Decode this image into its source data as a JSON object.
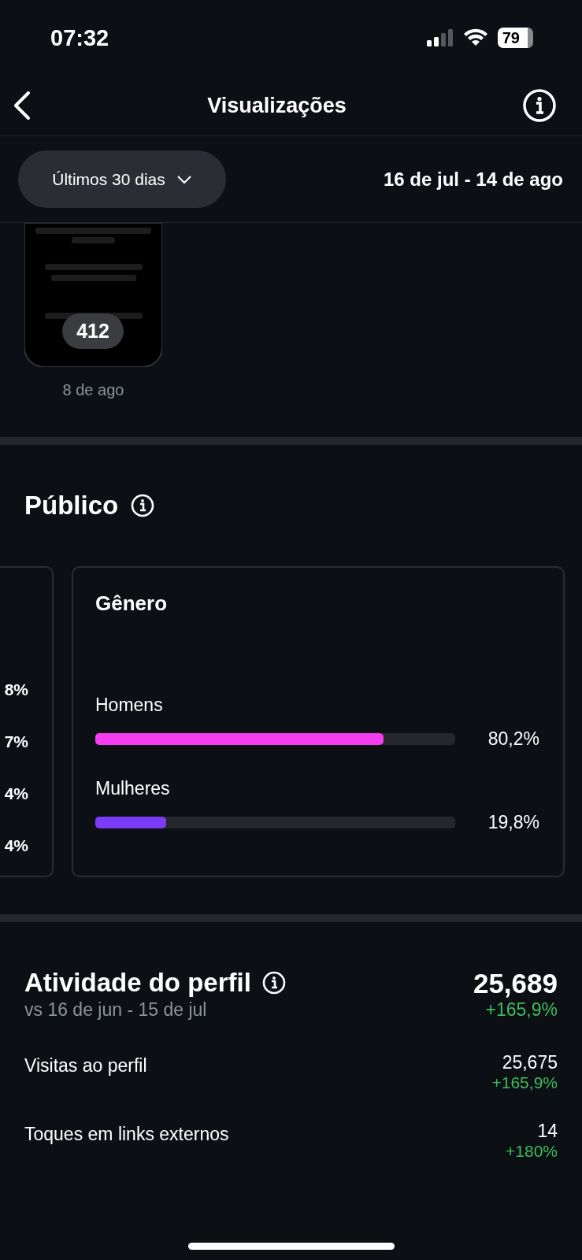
{
  "status_bar": {
    "time": "07:32",
    "battery": "79"
  },
  "header": {
    "title": "Visualizações"
  },
  "filter": {
    "label": "Últimos 30 dias",
    "date_range": "16 de jul - 14 de ago"
  },
  "posts": [
    {
      "kind": "picture",
      "count": "412",
      "date": "8 de ago"
    }
  ],
  "audience": {
    "title": "Público",
    "partial_card": {
      "values": [
        "8%",
        "7%",
        "4%",
        "4%"
      ]
    },
    "gender_card": {
      "title": "Gênero",
      "rows": [
        {
          "label": "Homens",
          "level": 0.802,
          "value": "80,2%",
          "color": "#f43cf0"
        },
        {
          "label": "Mulheres",
          "level": 0.198,
          "value": "19,8%",
          "color": "#7a3cf5"
        }
      ]
    }
  },
  "activity": {
    "title": "Atividade do perfil",
    "comparison": "vs 16 de jun - 15 de jul",
    "total": "25,689",
    "change": "+165,9%",
    "metrics": [
      {
        "label": "Visitas ao perfil",
        "value": "25,675",
        "change": "+165,9%"
      },
      {
        "label": "Toques em links externos",
        "value": "14",
        "change": "+180%"
      }
    ]
  }
}
